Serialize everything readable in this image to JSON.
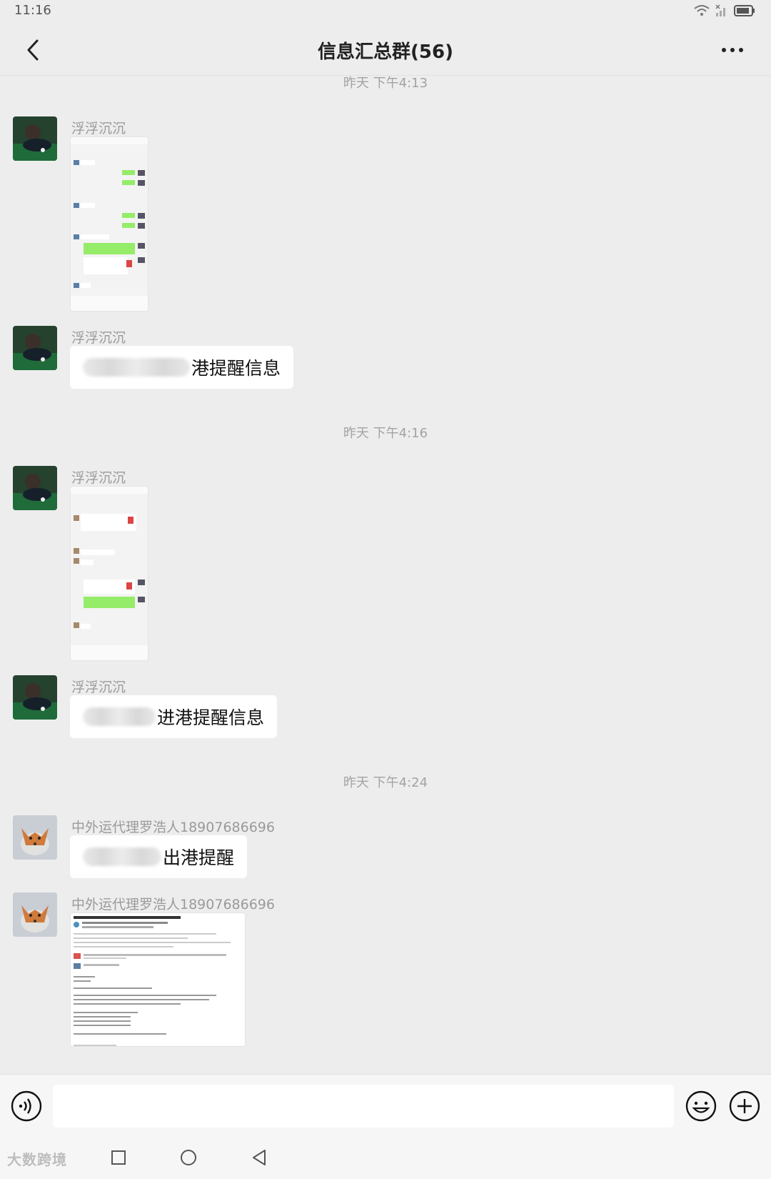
{
  "status_bar": {
    "time": "11:16"
  },
  "header": {
    "title": "信息汇总群(56)"
  },
  "messages": [
    {
      "timestamp": "昨天 下午4:13"
    },
    {
      "sender": "浮浮沉沉"
    },
    {
      "sender": "浮浮沉沉",
      "text": "港提醒信息"
    },
    {
      "timestamp": "昨天 下午4:16"
    },
    {
      "sender": "浮浮沉沉"
    },
    {
      "sender": "浮浮沉沉",
      "text": "进港提醒信息"
    },
    {
      "timestamp": "昨天 下午4:24"
    },
    {
      "sender": "中外运代理罗浩人18907686696",
      "text": "出港提醒"
    },
    {
      "sender": "中外运代理罗浩人18907686696"
    }
  ],
  "watermark": "大数跨境",
  "icons": {
    "back": "chevron-left-icon",
    "more": "more-dots-icon",
    "voice": "voice-icon",
    "emoji": "emoji-icon",
    "plus": "plus-icon",
    "nav_recent": "square-icon",
    "nav_home": "circle-icon",
    "nav_back": "triangle-back-icon"
  },
  "colors": {
    "background": "#ededed",
    "bubble": "#ffffff",
    "wechat_green": "#95ec69"
  }
}
